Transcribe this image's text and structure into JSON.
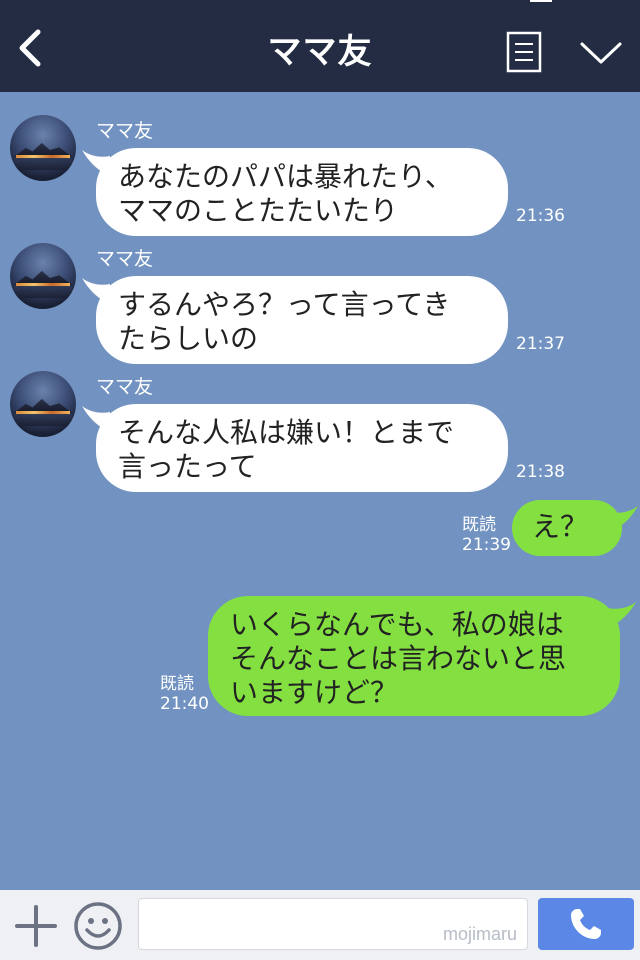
{
  "header": {
    "title": "ママ友",
    "back_icon": "chevron-left-icon",
    "menu_icon": "menu-lines-icon",
    "dropdown_icon": "chevron-down-icon"
  },
  "messages": [
    {
      "direction": "incoming",
      "sender": "ママ友",
      "text": "あなたのパパは暴れたり、\nママのことたたいたり",
      "time": "21:36"
    },
    {
      "direction": "incoming",
      "sender": "ママ友",
      "text": "するんやろ？って言ってき\nたらしいの",
      "time": "21:37"
    },
    {
      "direction": "incoming",
      "sender": "ママ友",
      "text": "そんな人私は嫌い！とまで\n言ったって",
      "time": "21:38"
    },
    {
      "direction": "outgoing",
      "text": "え？",
      "read": "既読",
      "time": "21:39"
    },
    {
      "direction": "outgoing",
      "text": "いくらなんでも、私の娘は\nそんなことは言わないと思\nいますけど？",
      "read": "既読",
      "time": "21:40"
    }
  ],
  "footer": {
    "plus_icon": "plus-icon",
    "emoji_icon": "smiley-icon",
    "input_value": "",
    "watermark": "mojimaru",
    "call_icon": "phone-icon"
  },
  "colors": {
    "header_bg": "#232c43",
    "chat_bg": "#7293c1",
    "incoming_bubble": "#ffffff",
    "outgoing_bubble": "#84e041",
    "call_button": "#5b88e6"
  }
}
